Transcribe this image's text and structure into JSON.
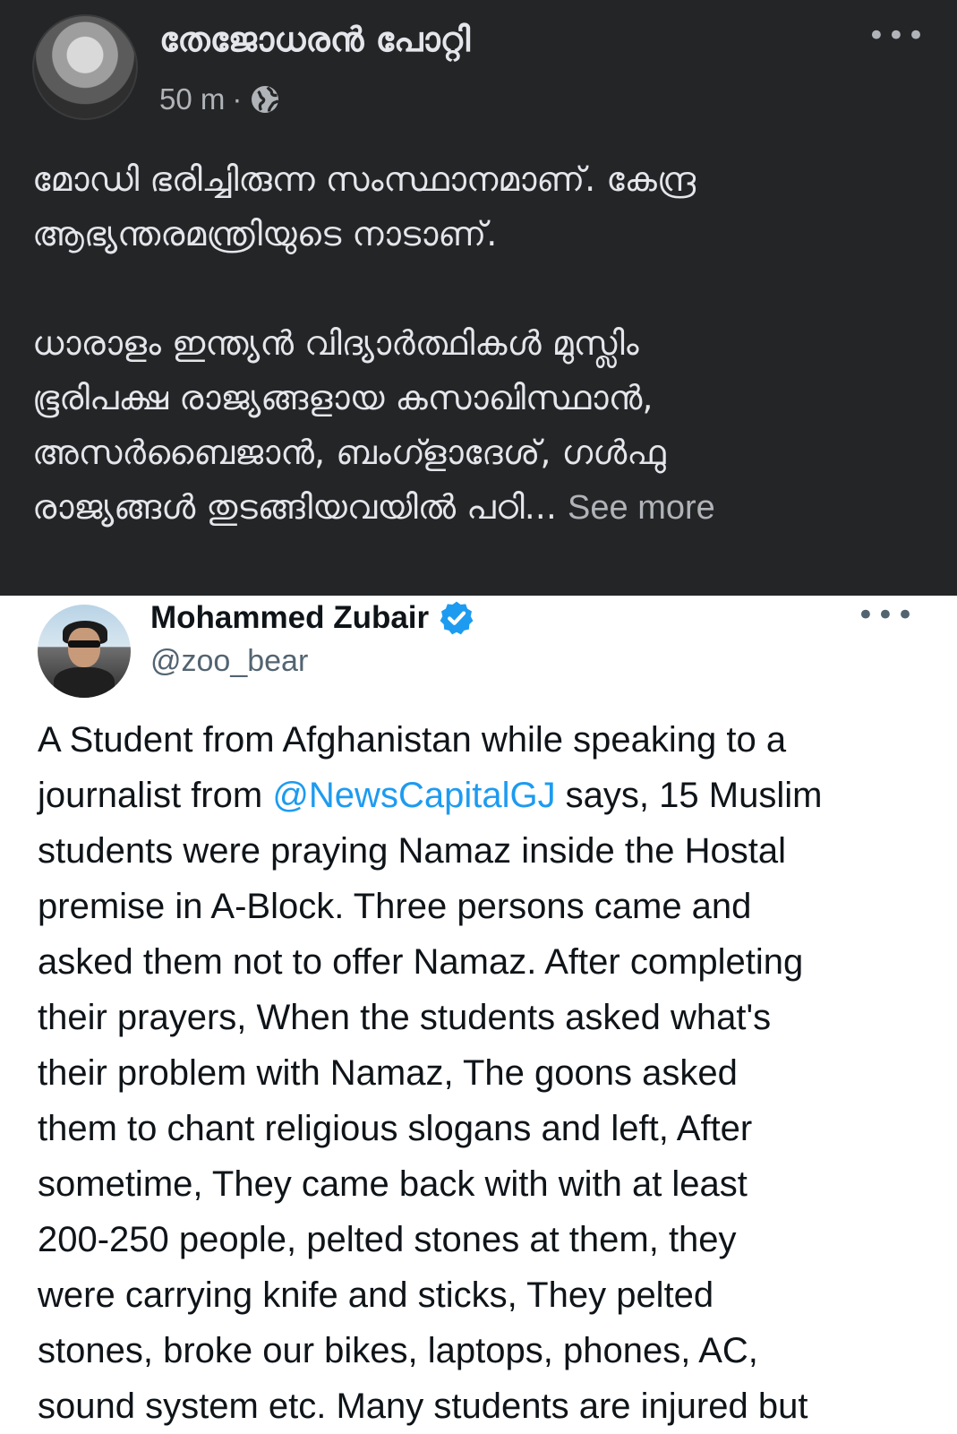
{
  "fb_post": {
    "author": "തേജോധരൻ പോറ്റി",
    "timestamp": "50 m",
    "separator": "·",
    "privacy_icon": "globe-icon",
    "more_label": "•••",
    "paragraph1_lines": [
      "മോഡി ഭരിച്ചിരുന്ന സംസ്ഥാനമാണ്.  കേന്ദ്ര",
      "ആഭ്യന്തരമന്ത്രിയുടെ നാടാണ്."
    ],
    "paragraph2_lines": [
      "ധാരാളം ഇന്ത്യൻ വിദ്യാർത്ഥികൾ മുസ്ലിം",
      "ഭൂരിപക്ഷ രാജ്യങ്ങളായ കസാഖിസ്ഥാൻ,",
      "അസർബൈജാൻ, ബംഗ്ളാദേശ്, ഗൾഫു"
    ],
    "last_line": "രാജ്യങ്ങൾ തുടങ്ങിയവയിൽ പഠി...",
    "see_more": "See more"
  },
  "tweet": {
    "name": "Mohammed Zubair",
    "verified_icon": "verified-badge-icon",
    "handle": "@zoo_bear",
    "more_label": "•••",
    "text_before": "A Student from Afghanistan while  speaking to a\njournalist from ",
    "mention": "@NewsCapitalGJ",
    "text_after": " says, 15 Muslim\nstudents were praying Namaz inside the Hostal\npremise in  A-Block. Three persons came and\nasked them not to offer Namaz. After completing\ntheir prayers, When the students asked what's\ntheir problem with Namaz, The goons asked\nthem to chant religious slogans and left, After\nsometime, They came back with with at least\n200-250 people, pelted stones at them, they\nwere carrying knife and sticks, They pelted\nstones, broke our bikes, laptops, phones, AC,\nsound system etc.  Many students are injured but"
  },
  "colors": {
    "fb_background": "#242526",
    "fb_text": "#e4e6eb",
    "fb_muted": "#b0b3b8",
    "tweet_text": "#0f1419",
    "tweet_muted": "#536471",
    "link_blue": "#1d9bf0"
  }
}
